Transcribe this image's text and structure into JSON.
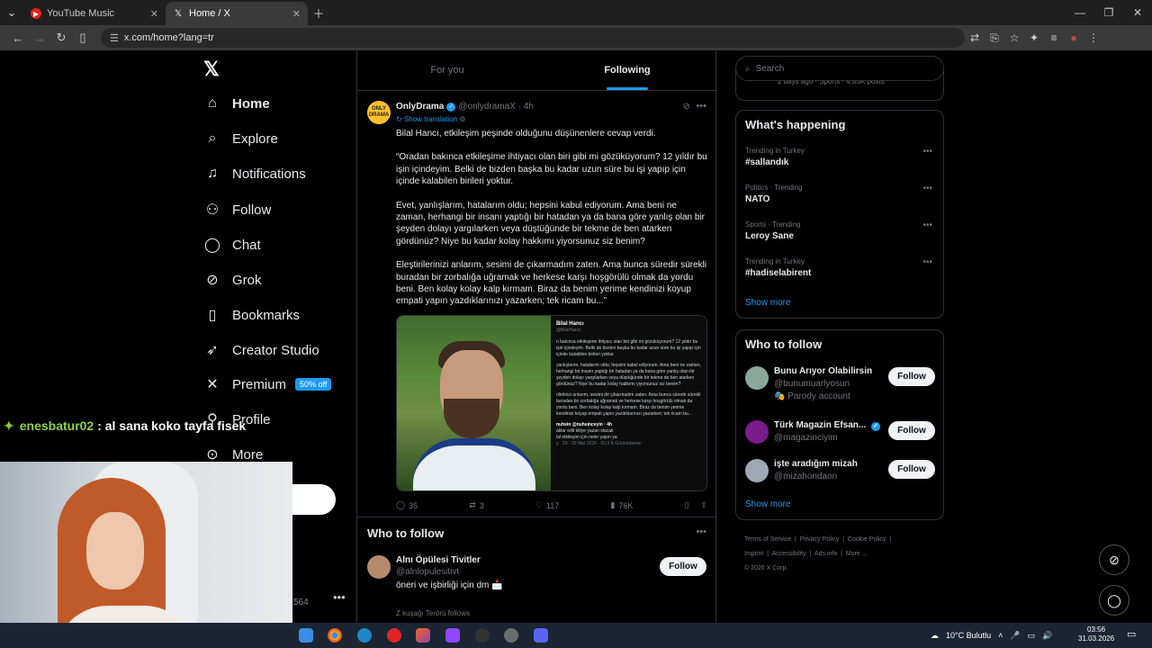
{
  "browser": {
    "tabs": [
      {
        "label": "YouTube Music",
        "active": false
      },
      {
        "label": "Home / X",
        "active": true
      }
    ],
    "url": "x.com/home?lang=tr"
  },
  "nav": {
    "items": [
      {
        "label": "Home",
        "icon": "home-icon"
      },
      {
        "label": "Explore",
        "icon": "search-icon"
      },
      {
        "label": "Notifications",
        "icon": "bell-icon"
      },
      {
        "label": "Follow",
        "icon": "add-person-icon"
      },
      {
        "label": "Chat",
        "icon": "chat-icon"
      },
      {
        "label": "Grok",
        "icon": "grok-icon"
      },
      {
        "label": "Bookmarks",
        "icon": "bookmark-icon"
      },
      {
        "label": "Creator Studio",
        "icon": "rocket-icon"
      },
      {
        "label": "Premium",
        "icon": "x-icon"
      },
      {
        "label": "Profile",
        "icon": "person-icon"
      },
      {
        "label": "More",
        "icon": "more-circle-icon"
      }
    ],
    "premium_badge": "50% off",
    "account_count": "564"
  },
  "timeline": {
    "tabs": [
      "For you",
      "Following"
    ],
    "selected_tab": "Following"
  },
  "post": {
    "name": "OnlyDrama",
    "handle": "@onlydramaX",
    "time": "4h",
    "avatar_text": "ONLY DRAMA",
    "translate": "Show translation",
    "paragraphs": [
      "Bilal Hancı, etkileşim peşinde olduğunu düşünenlere cevap verdi.",
      "“Oradan bakınca etkileşime ihtiyacı olan biri gibi mi gözüküyorum? 12 yıldır bu işin içindeyim. Belki de bizden başka bu kadar uzun süre bu işi yapıp için içinde kalabilen birileri yoktur.",
      "Evet, yanlışlarım, hatalarım oldu; hepsini kabul ediyorum. Ama beni ne zaman, herhangi bir insanı yaptığı bir hatadan ya da bana göre yanlış olan bir şeyden dolayı yargılarken veya düştüğünde bir tekme de ben atarken gördünüz? Niye bu kadar kolay hakkımı yiyorsunuz siz benim?",
      "Eleştirilerinizi anlarım, sesimi de çıkarmadım zaten. Ama bunca süredir sürekli buradan bir zorbalığa uğramak ve herkese karşı hoşgörülü olmak da yordu beni. Ben kolay kolay kalp kırmam. Biraz da benim yerime kendinizi koyup empati yapın yazdıklarınızı yazarken; tek ricam bu...”"
    ],
    "image_quote": {
      "name": "Bilal Hancı",
      "handle": "@BilalHanci",
      "lines": [
        "n bakınca etkileşime ihtiyacı olan biri gibi mi gözüküyorum? 12 yıldır bu işin içindeyim. Belki de bizden başka bu kadar uzun süre bu işi yapıp için içinde kalabilen birileri yoktur.",
        "yanlışlarım, hatalarım oldu; hepsini kabul ediyorum. Ama beni ne zaman, herhangi bir insanı yaptığı bir hatadan ya da bana göre yanlış olan bir şeyden dolayı yargılarken veya düştüğünde bir tekme de ben atarken gördünüz? Niye bu kadar kolay hakkımı yiyorsunuz siz benim?",
        "rilerinizi anlarım, sesimi de çıkarmadım zaten. Ama bunca süredir sürekli buradan bir zorbalığa uğramak ve herkese karşı hoşgörülü olmak da yordu beni. Ben kolay kolay kalp kırmam. Biraz da benim yerime kendinizi koyup empati yapın yazdıklarınızı yazarken; tek ricam bu...",
        "nuhsin @nuhsinceyin · 4h",
        "aklar edit kitiye yazan olacak",
        "lal etkileşim için neler yapın ya",
        "ş · 29 - 30 Mar 2026 · 50,9 B Görüntüleme"
      ]
    },
    "stats": {
      "replies": "35",
      "reposts": "3",
      "likes": "117",
      "views": "76K"
    }
  },
  "center_wtf": {
    "title": "Who to follow",
    "name": "Alnı Öpülesi Tivitler",
    "handle": "@alnlopulesitivt",
    "bio": "öneri ve işbirliği için dm 📩",
    "button": "Follow",
    "next_note": "Z kuşağı Terörü follows"
  },
  "right": {
    "search_placeholder": "Search",
    "top_snippet": "2 days ago · Sports · 4,85K posts",
    "happening_title": "What's happening",
    "trends": [
      {
        "meta": "Trending in Turkey",
        "title": "#sallandık"
      },
      {
        "meta": "Politics · Trending",
        "title": "NATO"
      },
      {
        "meta": "Sports · Trending",
        "title": "Leroy Sane"
      },
      {
        "meta": "Trending in Turkey",
        "title": "#hadiselabirent"
      }
    ],
    "show_more": "Show more",
    "wtf_title": "Who to follow",
    "wtf": [
      {
        "name": "Bunu Arıyor Olabilirsin",
        "handle": "@bunumuarlyosun",
        "extra": "🎭 Parody account",
        "button": "Follow"
      },
      {
        "name": "Türk Magazin Efsan...",
        "handle": "@magazinciyim",
        "extra": "",
        "button": "Follow"
      },
      {
        "name": "işte aradığım mizah",
        "handle": "@mizahondaon",
        "extra": "",
        "button": "Follow"
      }
    ],
    "footer": [
      "Terms of Service",
      "Privacy Policy",
      "Cookie Policy",
      "Imprint",
      "Accessibility",
      "Ads info",
      "More ...",
      "© 2026 X Corp."
    ]
  },
  "stream": {
    "chat_user": "enesbatur02",
    "chat_message": ": al sana koko tayfa fisek"
  },
  "taskbar": {
    "weather": "10°C Bulutlu",
    "time": "03:56",
    "date": "31.03.2026"
  }
}
